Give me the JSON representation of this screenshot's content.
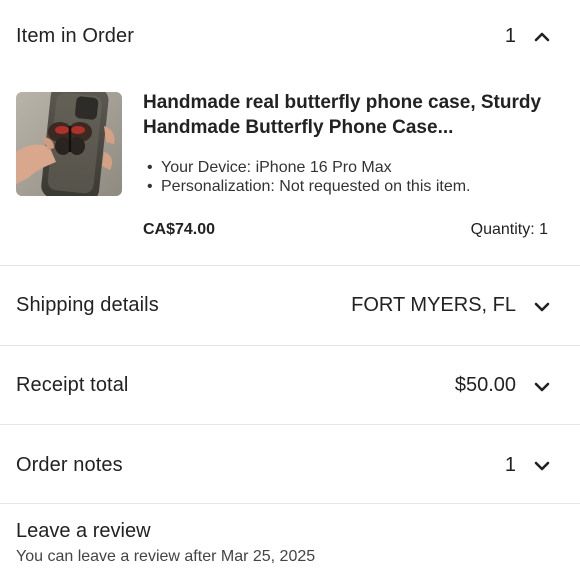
{
  "item_section": {
    "title": "Item in Order",
    "count": "1",
    "chevron_icon": "chevron-up-icon"
  },
  "item": {
    "image_icon": "butterfly-phone-case-photo",
    "title": "Handmade real butterfly phone case, Sturdy Handmade Butterfly Phone Case...",
    "options": [
      "Your Device: iPhone 16 Pro Max",
      "Personalization:  Not requested on this item."
    ],
    "price": "CA$74.00",
    "quantity": "Quantity: 1"
  },
  "shipping": {
    "label": "Shipping details",
    "value": "FORT MYERS, FL",
    "chevron_icon": "chevron-down-icon"
  },
  "receipt": {
    "label": "Receipt total",
    "value": "$50.00",
    "chevron_icon": "chevron-down-icon"
  },
  "notes": {
    "label": "Order notes",
    "value": "1",
    "chevron_icon": "chevron-down-icon"
  },
  "review": {
    "title": "Leave a review",
    "subtitle": "You can leave a review after Mar 25, 2025"
  }
}
